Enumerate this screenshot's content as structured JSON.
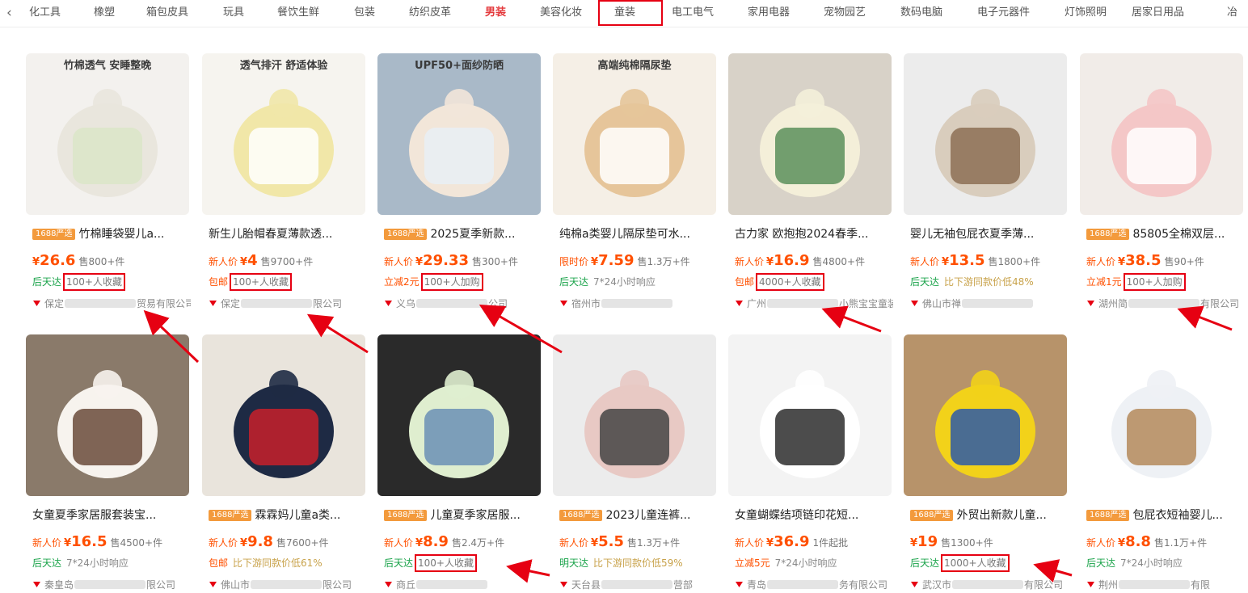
{
  "category_bar": {
    "back_icon": "chevron-left-icon",
    "active_index": 7,
    "items": [
      "化工具",
      "橡塑",
      "箱包皮具",
      "玩具",
      "餐饮生鲜",
      "包装",
      "纺织皮革",
      "男装",
      "美容化妆",
      "童装",
      "电工电气",
      "家用电器",
      "宠物园艺",
      "数码电脑",
      "电子元器件",
      "灯饰照明",
      "居家日用品",
      "冶"
    ]
  },
  "colors": {
    "accent": "#ff5000",
    "highlight_box": "#e60012",
    "green": "#1aa34a",
    "badge": "#f39a3c"
  },
  "products": [
    {
      "badge": "1688严选",
      "title": "竹棉睡袋婴儿a...",
      "price_tag": "",
      "price": "26.6",
      "sold": "售800+件",
      "service": "后天达",
      "service_color": "green",
      "extra": "100+人收藏",
      "extra_highlighted": true,
      "shop_prefix": "保定",
      "shop_suffix": "贸易有限公司",
      "image_text": "竹棉透气 安睡整晚"
    },
    {
      "badge": "",
      "title": "新生儿胎帽春夏薄款透...",
      "price_tag": "新人价",
      "price": "4",
      "sold": "售9700+件",
      "service": "包邮",
      "service_color": "red",
      "extra": "100+人收藏",
      "extra_highlighted": true,
      "shop_prefix": "保定",
      "shop_suffix": "限公司",
      "image_text": "透气排汗 舒适体验"
    },
    {
      "badge": "1688严选",
      "title": "2025夏季新款...",
      "price_tag": "新人价",
      "price": "29.33",
      "sold": "售300+件",
      "service": "立减2元",
      "service_color": "red",
      "extra": "100+人加购",
      "extra_highlighted": true,
      "shop_prefix": "义乌",
      "shop_suffix": "公司",
      "image_text": "UPF50+面纱防晒"
    },
    {
      "badge": "",
      "title": "纯棉a类婴儿隔尿垫可水...",
      "price_tag": "限时价",
      "price": "7.59",
      "sold": "售1.3万+件",
      "service": "后天达",
      "service_color": "green",
      "extra": "7*24小时响应",
      "extra_highlighted": false,
      "shop_prefix": "宿州市",
      "shop_suffix": "",
      "image_text": "高端纯棉隔尿垫"
    },
    {
      "badge": "",
      "title": "古力家 欧抱抱2024春季...",
      "price_tag": "新人价",
      "price": "16.9",
      "sold": "售4800+件",
      "service": "包邮",
      "service_color": "red",
      "extra": "4000+人收藏",
      "extra_highlighted": true,
      "shop_prefix": "广州",
      "shop_suffix": "小熊宝宝童装",
      "image_text": ""
    },
    {
      "badge": "",
      "title": "婴儿无袖包屁衣夏季薄...",
      "price_tag": "新人价",
      "price": "13.5",
      "sold": "售1800+件",
      "service": "后天达",
      "service_color": "green",
      "extra": "比下游同款价低48%",
      "extra_highlighted": false,
      "shop_prefix": "佛山市禅",
      "shop_suffix": "",
      "image_text": ""
    },
    {
      "badge": "1688严选",
      "title": "85805全棉双层...",
      "price_tag": "新人价",
      "price": "38.5",
      "sold": "售90+件",
      "service": "立减1元",
      "service_color": "red",
      "extra": "100+人加购",
      "extra_highlighted": true,
      "shop_prefix": "湖州简",
      "shop_suffix": "有限公司",
      "image_text": ""
    },
    {
      "badge": "",
      "title": "女童夏季家居服套装宝...",
      "price_tag": "新人价",
      "price": "16.5",
      "sold": "售4500+件",
      "service": "后天达",
      "service_color": "green",
      "extra": "7*24小时响应",
      "extra_highlighted": false,
      "shop_prefix": "秦皇岛",
      "shop_suffix": "限公司",
      "image_text": ""
    },
    {
      "badge": "1688严选",
      "title": "霖霖妈儿童a类...",
      "price_tag": "新人价",
      "price": "9.8",
      "sold": "售7600+件",
      "service": "包邮",
      "service_color": "red",
      "extra": "比下游同款价低61%",
      "extra_highlighted": false,
      "shop_prefix": "佛山市",
      "shop_suffix": "限公司",
      "image_text": ""
    },
    {
      "badge": "1688严选",
      "title": "儿童夏季家居服...",
      "price_tag": "新人价",
      "price": "8.9",
      "sold": "售2.4万+件",
      "service": "后天达",
      "service_color": "green",
      "extra": "100+人收藏",
      "extra_highlighted": true,
      "shop_prefix": "商丘",
      "shop_suffix": "",
      "image_text": ""
    },
    {
      "badge": "1688严选",
      "title": "2023儿童连裤...",
      "price_tag": "新人价",
      "price": "5.5",
      "sold": "售1.3万+件",
      "service": "明天达",
      "service_color": "green",
      "extra": "比下游同款价低59%",
      "extra_highlighted": false,
      "shop_prefix": "天台县",
      "shop_suffix": "营部",
      "image_text": ""
    },
    {
      "badge": "",
      "title": "女童蝴蝶结项链印花短...",
      "price_tag": "新人价",
      "price": "36.9",
      "sold": "1件起批",
      "service": "立减5元",
      "service_color": "red",
      "extra": "7*24小时响应",
      "extra_highlighted": false,
      "shop_prefix": "青岛",
      "shop_suffix": "务有限公司",
      "image_text": ""
    },
    {
      "badge": "1688严选",
      "title": "外贸出新款儿童...",
      "price_tag": "",
      "price": "19",
      "sold": "售1300+件",
      "service": "后天达",
      "service_color": "green",
      "extra": "1000+人收藏",
      "extra_highlighted": true,
      "shop_prefix": "武汉市",
      "shop_suffix": "有限公司",
      "image_text": ""
    },
    {
      "badge": "1688严选",
      "title": "包屁衣短袖婴儿...",
      "price_tag": "新人价",
      "price": "8.8",
      "sold": "售1.1万+件",
      "service": "后天达",
      "service_color": "green",
      "extra": "7*24小时响应",
      "extra_highlighted": false,
      "shop_prefix": "荆州",
      "shop_suffix": "有限",
      "image_text": ""
    }
  ]
}
